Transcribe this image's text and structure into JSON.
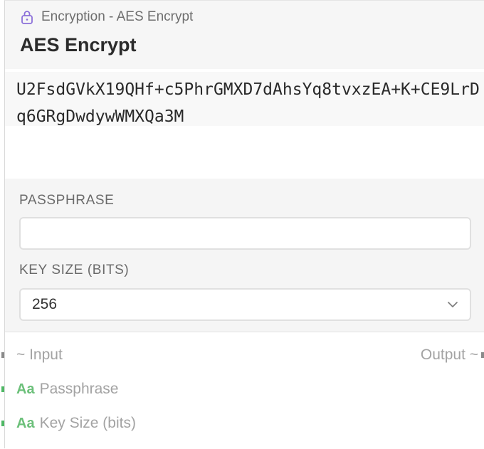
{
  "node": {
    "category": "Encryption - AES Encrypt",
    "title": "AES Encrypt",
    "output_value": "U2FsdGVkX19QHf+c5PhrGMXD7dAhsYq8tvxzEA+K+CE9LrDq6GRgDwdywWMXQa3M"
  },
  "fields": {
    "passphrase": {
      "label": "PASSPHRASE",
      "value": "",
      "placeholder": ""
    },
    "key_size": {
      "label": "KEY SIZE (BITS)",
      "selected": "256"
    }
  },
  "ports": {
    "input_label": "~ Input",
    "output_label": "Output ~",
    "passphrase_type": "Aa",
    "passphrase_label": "Passphrase",
    "key_size_type": "Aa",
    "key_size_label": "Key Size (bits)"
  },
  "icons": {
    "category": "lock-icon",
    "select": "chevron-down-icon"
  },
  "colors": {
    "accent": "#8b6fd9",
    "string_port": "#4fb865",
    "flow_port": "#8a8a8a"
  }
}
